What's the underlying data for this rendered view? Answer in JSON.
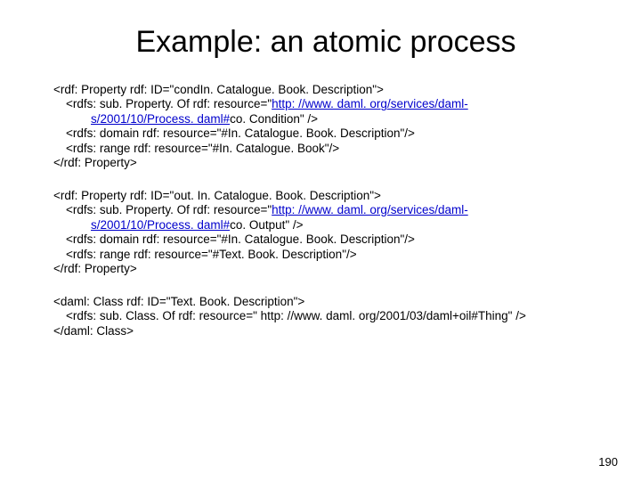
{
  "title": "Example: an atomic process",
  "block1": {
    "l1a": "<rdf: Property rdf: ID=\"cond",
    "l1b": "In. Catalogue. Book. Description\">",
    "l2a": "<rdfs: sub. Property. Of rdf: resource=\"",
    "l2link": "http: //www. daml. org/services/daml-",
    "l3link": "s/2001/10/Process. daml#",
    "l3b": "co. Condition\" />",
    "l4": "<rdfs: domain rdf: resource=\"#In. Catalogue. Book. Description\"/>",
    "l5": "<rdfs: range rdf: resource=\"#In. Catalogue. Book\"/>",
    "l6": "</rdf: Property>"
  },
  "block2": {
    "l1": "<rdf: Property rdf: ID=\"out. In. Catalogue. Book. Description\">",
    "l2a": "<rdfs: sub. Property. Of rdf: resource=\"",
    "l2link": "http: //www. daml. org/services/daml-",
    "l3link": "s/2001/10/Process. daml#",
    "l3b": "co. Output\" />",
    "l4": "<rdfs: domain rdf: resource=\"#In. Catalogue. Book. Description\"/>",
    "l5": "<rdfs: range rdf: resource=\"#Text. Book. Description\"/>",
    "l6": "</rdf: Property>"
  },
  "block3": {
    "l1": "<daml: Class rdf: ID=\"Text. Book. Description\">",
    "l2": "<rdfs: sub. Class. Of rdf: resource=\" http: //www. daml. org/2001/03/daml+oil#Thing\" />",
    "l3": "</daml: Class>"
  },
  "pagenum": "190"
}
